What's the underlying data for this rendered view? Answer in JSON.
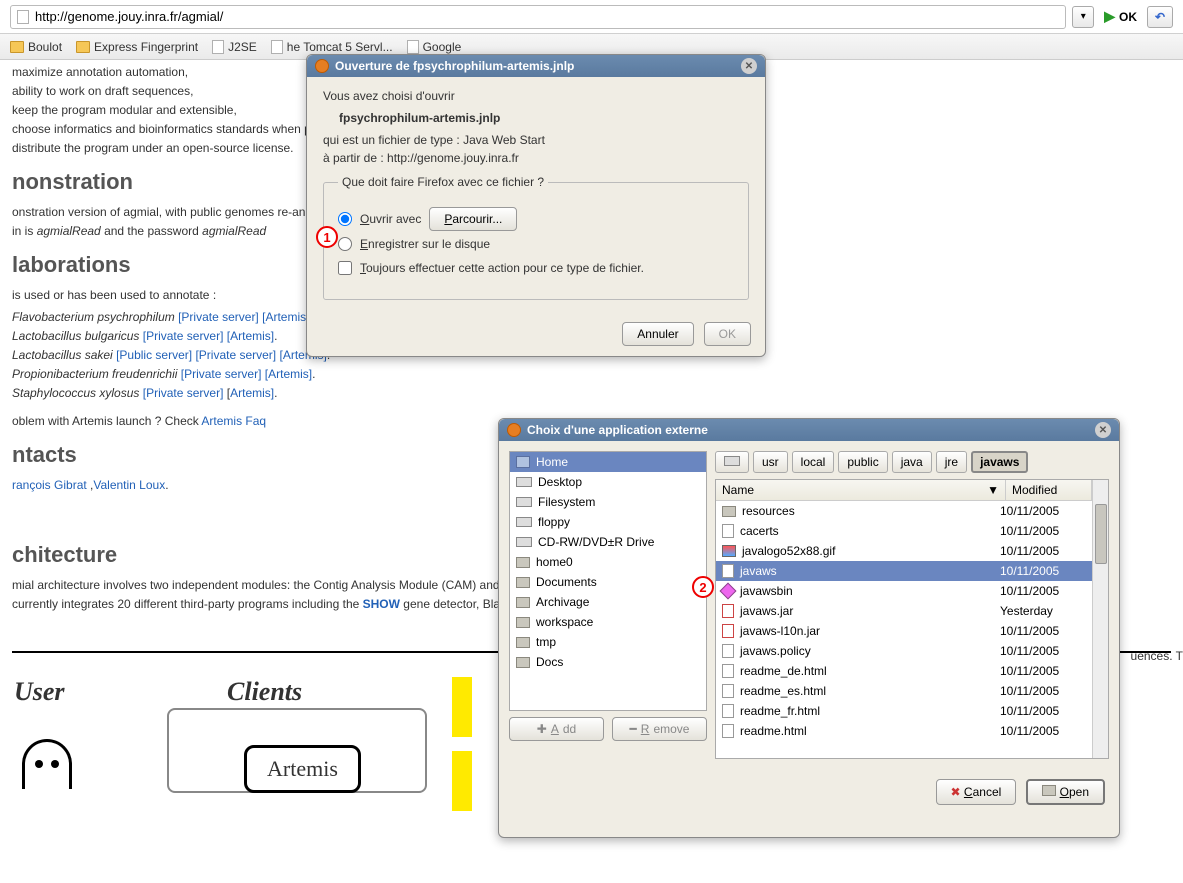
{
  "url": "http://genome.jouy.inra.fr/agmial/",
  "okLabel": "OK",
  "bookmarks": [
    {
      "icon": "folder",
      "label": "Boulot"
    },
    {
      "icon": "folder",
      "label": "Express Fingerprint"
    },
    {
      "icon": "file",
      "label": "J2SE"
    },
    {
      "icon": "file",
      "label": "he Tomcat 5 Servl..."
    },
    {
      "icon": "file",
      "label": "Google"
    }
  ],
  "page": {
    "bullets": [
      "maximize annotation automation,",
      "ability to work on draft sequences,",
      "keep the program modular and extensible,",
      "choose informatics and bioinformatics standards when poss",
      "distribute the program under an open-source license."
    ],
    "h_demo": "nonstration",
    "demo1": "onstration version of agmial, with public genomes re-annoted,",
    "demo2_pre": "in is ",
    "demo2_i1": "agmialRead",
    "demo2_mid": " and the password ",
    "demo2_i2": "agmialRead",
    "h_collab": "laborations",
    "collab_intro": "is used or has been used to annotate :",
    "species": [
      {
        "name": "Flavobacterium psychrophilum",
        "links": [
          "[Private server]",
          "[Artemis]"
        ]
      },
      {
        "name": "Lactobacillus bulgaricus",
        "links": [
          "[Private server]",
          "[Artemis]"
        ]
      },
      {
        "name": "Lactobacillus sakei",
        "links": [
          "[Public server]",
          "[Private server]",
          "[Artemis]"
        ]
      },
      {
        "name": "Propionibacterium freudenrichii",
        "links": [
          "[Private server]",
          "[Artemis]"
        ]
      },
      {
        "name": "Staphylococcus xylosus",
        "links": [
          "[Private server]"
        ],
        "extra": "[",
        "extra2": "Artemis]"
      }
    ],
    "faq_pre": "oblem with Artemis launch ? Check ",
    "faq_link": "Artemis Faq",
    "h_contacts": "ntacts",
    "contacts_a": "rançois Gibrat",
    "contacts_sep": " ,",
    "contacts_b": "Valentin Loux",
    "contacts_end": ".",
    "h_arch": "chitecture",
    "arch1_a": "mial architecture involves two independent modules: the Contig Analysis Module (CAM) and the Prote",
    "arch1_end": "uences. T",
    "arch2_a": " currently integrates 20 different third-party programs including the ",
    "arch2_show": "SHOW",
    "arch2_b": " gene detector, Blast and th",
    "user": "User",
    "clients": "Clients",
    "artemis": "Artemis"
  },
  "dlg1": {
    "title": "Ouverture de fpsychrophilum-artemis.jnlp",
    "intro": "Vous avez choisi d'ouvrir",
    "fname": "fpsychrophilum-artemis.jnlp",
    "type_pre": "qui est un fichier de type  :  ",
    "type_val": "Java Web Start",
    "from_pre": "à partir de  :  ",
    "from_val": "http://genome.jouy.inra.fr",
    "legend": "Que doit faire Firefox avec ce fichier ?",
    "open_with": "Ouvrir avec",
    "browse": "Parcourir...",
    "save": "Enregistrer sur le disque",
    "always": "Toujours effectuer cette action pour ce type de fichier.",
    "cancel": "Annuler",
    "ok": "OK"
  },
  "dlg2": {
    "title": "Choix d'une application externe",
    "places": [
      {
        "icon": "home",
        "label": "Home",
        "sel": true
      },
      {
        "icon": "drive",
        "label": "Desktop"
      },
      {
        "icon": "drive",
        "label": "Filesystem"
      },
      {
        "icon": "drive",
        "label": "floppy"
      },
      {
        "icon": "drive",
        "label": "CD-RW/DVD±R Drive"
      },
      {
        "icon": "folder",
        "label": "home0"
      },
      {
        "icon": "folder",
        "label": "Documents"
      },
      {
        "icon": "folder",
        "label": "Archivage"
      },
      {
        "icon": "folder",
        "label": "workspace"
      },
      {
        "icon": "folder",
        "label": "tmp"
      },
      {
        "icon": "folder",
        "label": "Docs"
      }
    ],
    "crumbs": [
      "",
      "usr",
      "local",
      "public",
      "java",
      "jre",
      "javaws"
    ],
    "crumb_home_icon": "home",
    "cols": {
      "name": "Name",
      "mod": "Modified"
    },
    "files": [
      {
        "icon": "folder",
        "name": "resources",
        "mod": "10/11/2005"
      },
      {
        "icon": "file",
        "name": "cacerts",
        "mod": "10/11/2005"
      },
      {
        "icon": "img",
        "name": "javalogo52x88.gif",
        "mod": "10/11/2005"
      },
      {
        "icon": "file",
        "name": "javaws",
        "mod": "10/11/2005",
        "sel": true
      },
      {
        "icon": "exec",
        "name": "javawsbin",
        "mod": "10/11/2005"
      },
      {
        "icon": "jar",
        "name": "javaws.jar",
        "mod": "Yesterday"
      },
      {
        "icon": "jar",
        "name": "javaws-l10n.jar",
        "mod": "10/11/2005"
      },
      {
        "icon": "file",
        "name": "javaws.policy",
        "mod": "10/11/2005"
      },
      {
        "icon": "file",
        "name": "readme_de.html",
        "mod": "10/11/2005"
      },
      {
        "icon": "file",
        "name": "readme_es.html",
        "mod": "10/11/2005"
      },
      {
        "icon": "file",
        "name": "readme_fr.html",
        "mod": "10/11/2005"
      },
      {
        "icon": "file",
        "name": "readme.html",
        "mod": "10/11/2005"
      }
    ],
    "add": "Add",
    "remove": "Remove",
    "cancel": "Cancel",
    "open": "Open"
  },
  "callouts": {
    "c1": "1",
    "c2": "2"
  }
}
